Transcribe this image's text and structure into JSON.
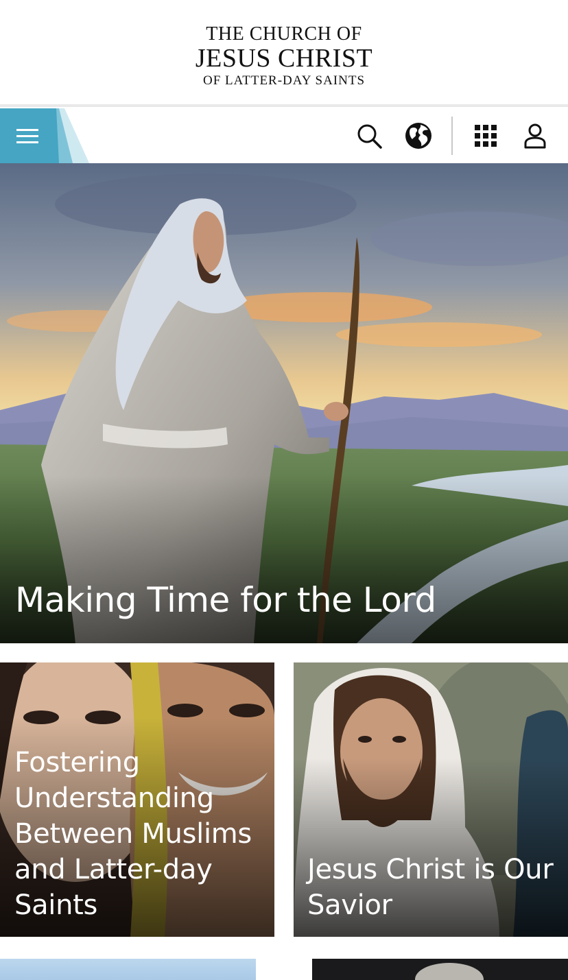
{
  "logo": {
    "line1": "THE CHURCH OF",
    "line2": "JESUS CHRIST",
    "line3": "OF LATTER-DAY SAINTS"
  },
  "nav": {
    "menu_icon": "hamburger-menu-icon",
    "search_icon": "search-icon",
    "language_icon": "globe-icon",
    "apps_icon": "apps-grid-icon",
    "account_icon": "user-icon",
    "accent_color": "#45a5c3"
  },
  "hero": {
    "title": "Making Time for the Lord"
  },
  "cards": [
    {
      "title": "Fostering Understanding Between Muslims and Latter-day Saints"
    },
    {
      "title": "Jesus Christ is Our Savior"
    }
  ]
}
